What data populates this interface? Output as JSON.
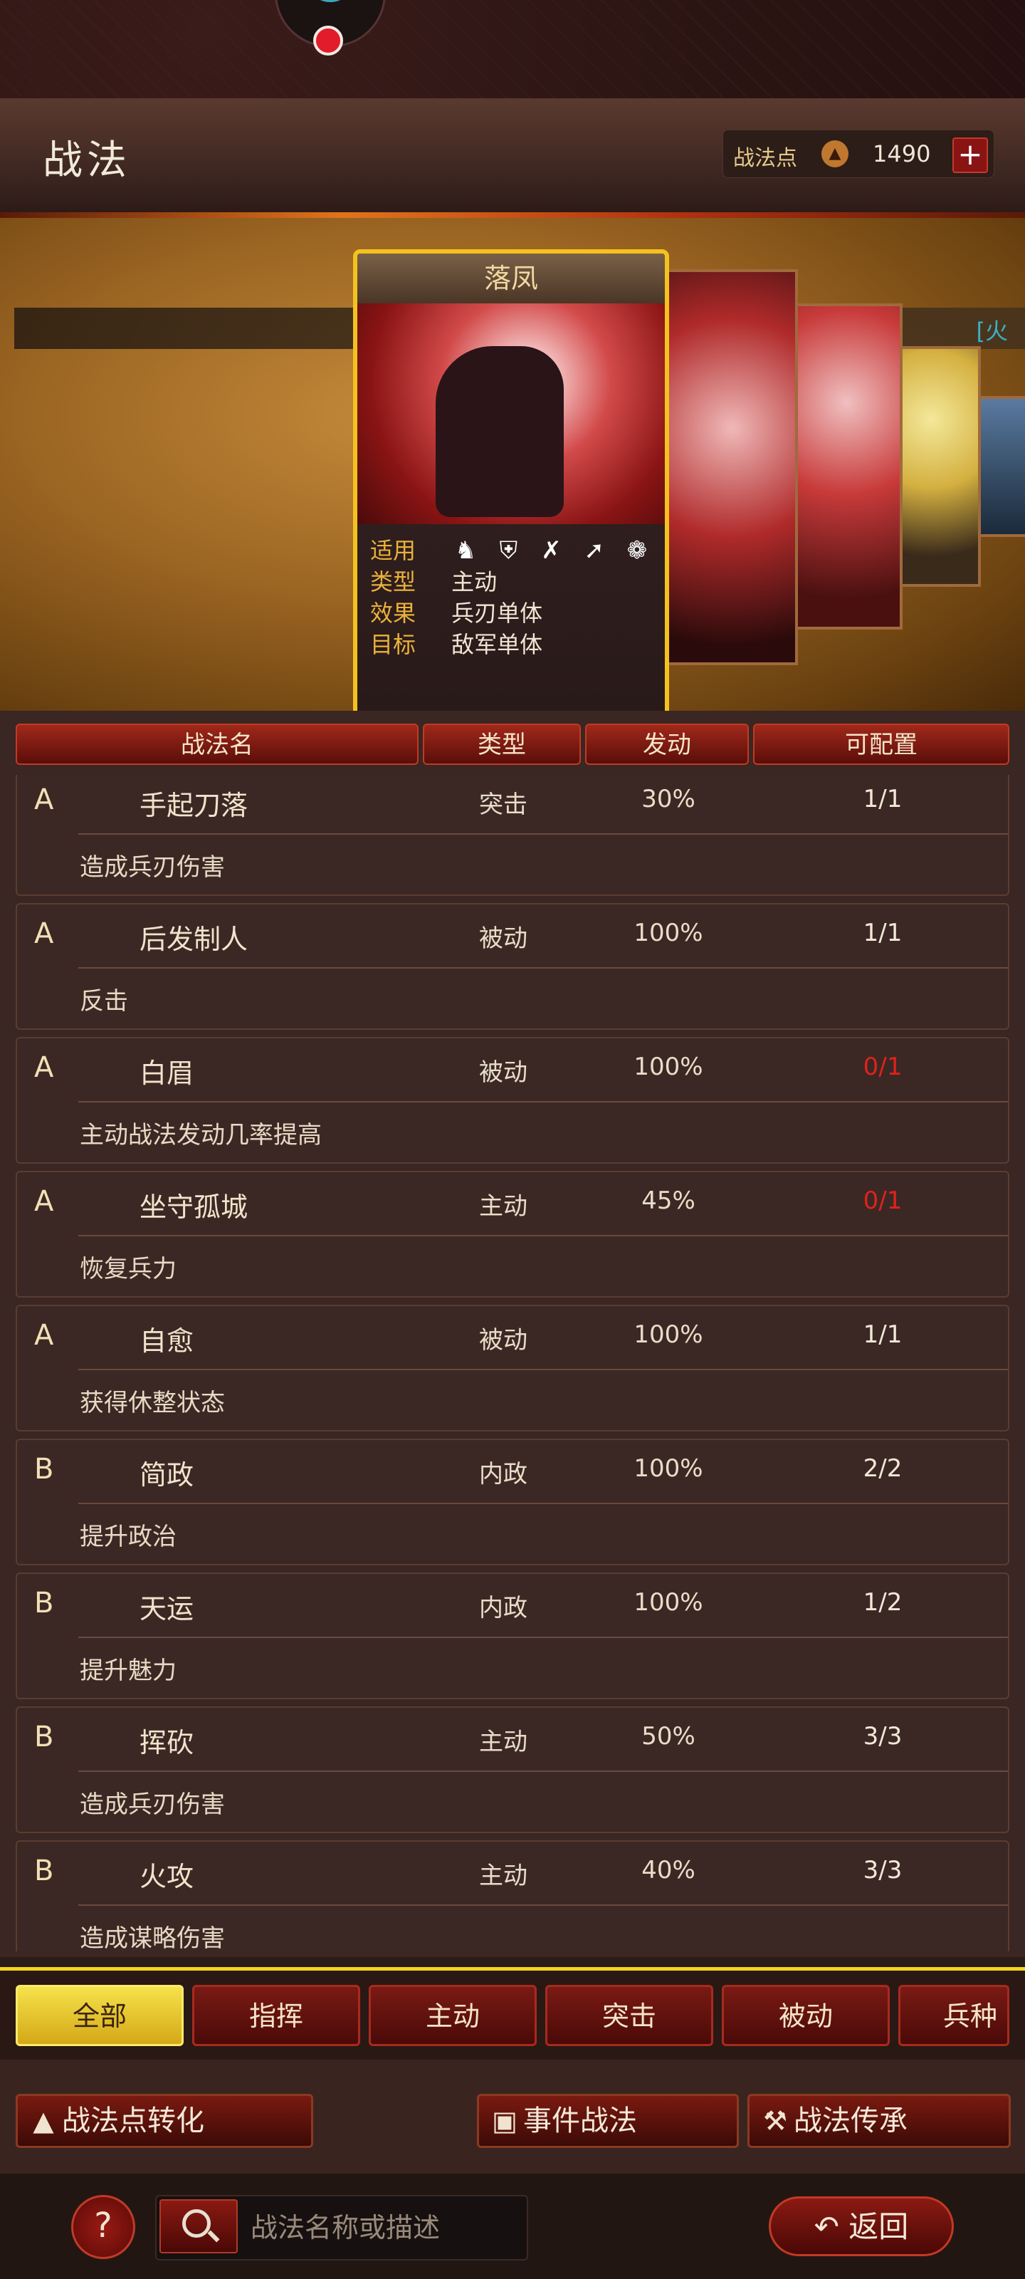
{
  "header": {
    "title": "战法",
    "points_label": "战法点",
    "points_value": "1490",
    "add_label": "+"
  },
  "showcase": {
    "banner_text": "[火",
    "card": {
      "title": "落凤",
      "rows": [
        {
          "key": "适用",
          "value": ""
        },
        {
          "key": "类型",
          "value": "主动"
        },
        {
          "key": "效果",
          "value": "兵刃单体"
        },
        {
          "key": "目标",
          "value": "敌军单体"
        }
      ],
      "unit_icons": [
        "cavalry-icon",
        "shield-icon",
        "bow-icon",
        "spear-icon",
        "wheel-icon"
      ]
    }
  },
  "table": {
    "headers": {
      "name": "战法名",
      "type": "类型",
      "trigger": "发动",
      "slots": "可配置"
    },
    "rows": [
      {
        "grade": "A",
        "name": "手起刀落",
        "type": "突击",
        "trigger": "30%",
        "slots": "1/1",
        "desc": "造成兵刃伤害"
      },
      {
        "grade": "A",
        "name": "后发制人",
        "type": "被动",
        "trigger": "100%",
        "slots": "1/1",
        "desc": "反击"
      },
      {
        "grade": "A",
        "name": "白眉",
        "type": "被动",
        "trigger": "100%",
        "slots": "0/1",
        "desc": "主动战法发动几率提高"
      },
      {
        "grade": "A",
        "name": "坐守孤城",
        "type": "主动",
        "trigger": "45%",
        "slots": "0/1",
        "desc": "恢复兵力"
      },
      {
        "grade": "A",
        "name": "自愈",
        "type": "被动",
        "trigger": "100%",
        "slots": "1/1",
        "desc": "获得休整状态"
      },
      {
        "grade": "B",
        "name": "简政",
        "type": "内政",
        "trigger": "100%",
        "slots": "2/2",
        "desc": "提升政治"
      },
      {
        "grade": "B",
        "name": "天运",
        "type": "内政",
        "trigger": "100%",
        "slots": "1/2",
        "desc": "提升魅力"
      },
      {
        "grade": "B",
        "name": "挥砍",
        "type": "主动",
        "trigger": "50%",
        "slots": "3/3",
        "desc": "造成兵刃伤害"
      },
      {
        "grade": "B",
        "name": "火攻",
        "type": "主动",
        "trigger": "40%",
        "slots": "3/3",
        "desc": "造成谋略伤害"
      }
    ]
  },
  "filters": [
    "全部",
    "指挥",
    "主动",
    "突击",
    "被动",
    "兵种"
  ],
  "actions": {
    "convert": "战法点转化",
    "event": "事件战法",
    "inherit": "战法传承"
  },
  "bottom": {
    "help": "?",
    "search_placeholder": "战法名称或描述",
    "back": "返回"
  },
  "colors": {
    "accent_yellow": "#f4c21e",
    "slot_red": "#e0221a",
    "header_red": "#a0281a"
  }
}
